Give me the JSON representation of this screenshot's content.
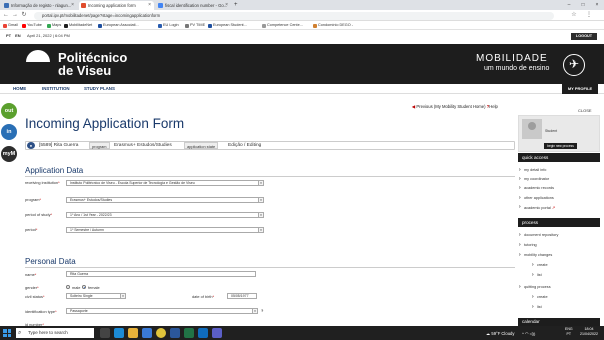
{
  "browser": {
    "tabs": [
      {
        "label": "Informação de registo - nlagun...",
        "color": "#3c6fb5"
      },
      {
        "label": "Incoming application form",
        "color": "#e04d2d",
        "active": true
      },
      {
        "label": "fiscal identification number - Go...",
        "color": "#4285f4"
      }
    ],
    "new_tab": "+",
    "url": "portal.ipv.pt/mobilitadenet/page?stage=incomingapplicationform",
    "bookmarks": [
      {
        "label": "Gmail",
        "color": "#ea4335"
      },
      {
        "label": "YouTube",
        "color": "#ff0000"
      },
      {
        "label": "Maps",
        "color": "#34a853"
      },
      {
        "label": "MobilitadeNet",
        "color": "#1d1d1d"
      },
      {
        "label": "European Associati...",
        "color": "#1e4fa0"
      },
      {
        "label": "EU Login",
        "color": "#2a5db0"
      },
      {
        "label": "PV TIME",
        "color": "#777"
      },
      {
        "label": "European Student...",
        "color": "#1e4fa0"
      },
      {
        "label": "Competence Cente...",
        "color": "#999"
      },
      {
        "label": "Condomínio DEGO -",
        "color": "#d08030"
      }
    ]
  },
  "site": {
    "lang_pt": "PT",
    "lang_en": "EN",
    "date": "April 21, 2022 | 6:04 PM",
    "logout": "LOGOUT",
    "logo_line1": "Politécnico",
    "logo_line2": "de Viseu",
    "mob_title": "MOBILIDADE",
    "mob_sub": "um mundo de ensino",
    "nav": [
      "HOME",
      "INSTITUTION",
      "STUDY PLANS"
    ],
    "my_profile": "MY PROFILE",
    "side_icons": [
      {
        "label": "out",
        "color": "#5ba02e"
      },
      {
        "label": "in",
        "color": "#2a6fb5"
      },
      {
        "label": "myM",
        "color": "#2d2d2d"
      }
    ]
  },
  "page": {
    "prev_link": "Previous (My Mobility Student Home)",
    "help": "Help",
    "close": "CLOSE",
    "title": "Incoming Application Form",
    "breadcrumb": {
      "id_badge": "●",
      "student": "[5589] Rita Guerra",
      "tag_program": "program",
      "program": "Erasmus+ Estudos/Studies",
      "tag_state": "application state",
      "state": "Edição / Editing"
    }
  },
  "application_data": {
    "heading": "Application Data",
    "fields": [
      {
        "label": "receiving institution",
        "value": "Instituto Politécnico de Viseu - Escola Superior de Tecnologia e Gestão de Viseu"
      },
      {
        "label": "program",
        "value": "Erasmus+ Estudos/Studies"
      },
      {
        "label": "period of study",
        "value": "1º Ano / 1st Year - 2022/23"
      },
      {
        "label": "period",
        "value": "1º Semestre / Autumn"
      }
    ]
  },
  "personal_data": {
    "heading": "Personal Data",
    "name_label": "name",
    "name_value": "Rita Guerra",
    "gender_label": "gender",
    "gender_male": "male",
    "gender_female": "female",
    "gender_selected": "female",
    "civil_label": "civil status",
    "civil_value": "Solteiro Single",
    "dob_label": "date of birth",
    "dob_value": "05/05/1977",
    "idtype_label": "identification type",
    "idtype_value": "Passaporte",
    "idtype_help": "?",
    "idnum_label": "id number"
  },
  "sidebar": {
    "student_label": "Student",
    "new_process": "begin new process",
    "quick_access": "quick access",
    "quick_links": [
      "my detail info",
      "my coordinator",
      "academic records",
      "other applications",
      "academic portal"
    ],
    "process": "process",
    "process_links": [
      {
        "label": "document repository",
        "sub": false
      },
      {
        "label": "tutoring",
        "sub": false
      },
      {
        "label": "mobility changes",
        "sub": false
      },
      {
        "label": "create",
        "sub": true
      },
      {
        "label": "list",
        "sub": true
      },
      {
        "label": "quitting process",
        "sub": false
      },
      {
        "label": "create",
        "sub": true
      },
      {
        "label": "list",
        "sub": true
      }
    ],
    "calendar": "calendar"
  },
  "taskbar": {
    "search_placeholder": "Type here to search",
    "weather": "59°F Cloudy",
    "lang1": "ENG",
    "lang2": "PT",
    "time": "18:04",
    "date": "21/04/2022",
    "apps": [
      {
        "name": "task-view",
        "color": "#444"
      },
      {
        "name": "edge",
        "color": "#1c8bd6"
      },
      {
        "name": "file-explorer",
        "color": "#e8b23a"
      },
      {
        "name": "store",
        "color": "#3a7ad6"
      },
      {
        "name": "chrome",
        "color": "#e0c43a"
      },
      {
        "name": "word",
        "color": "#2b579a"
      },
      {
        "name": "excel",
        "color": "#217346"
      },
      {
        "name": "outlook",
        "color": "#0f6cbd"
      },
      {
        "name": "teams",
        "color": "#5b5fc7"
      }
    ]
  }
}
